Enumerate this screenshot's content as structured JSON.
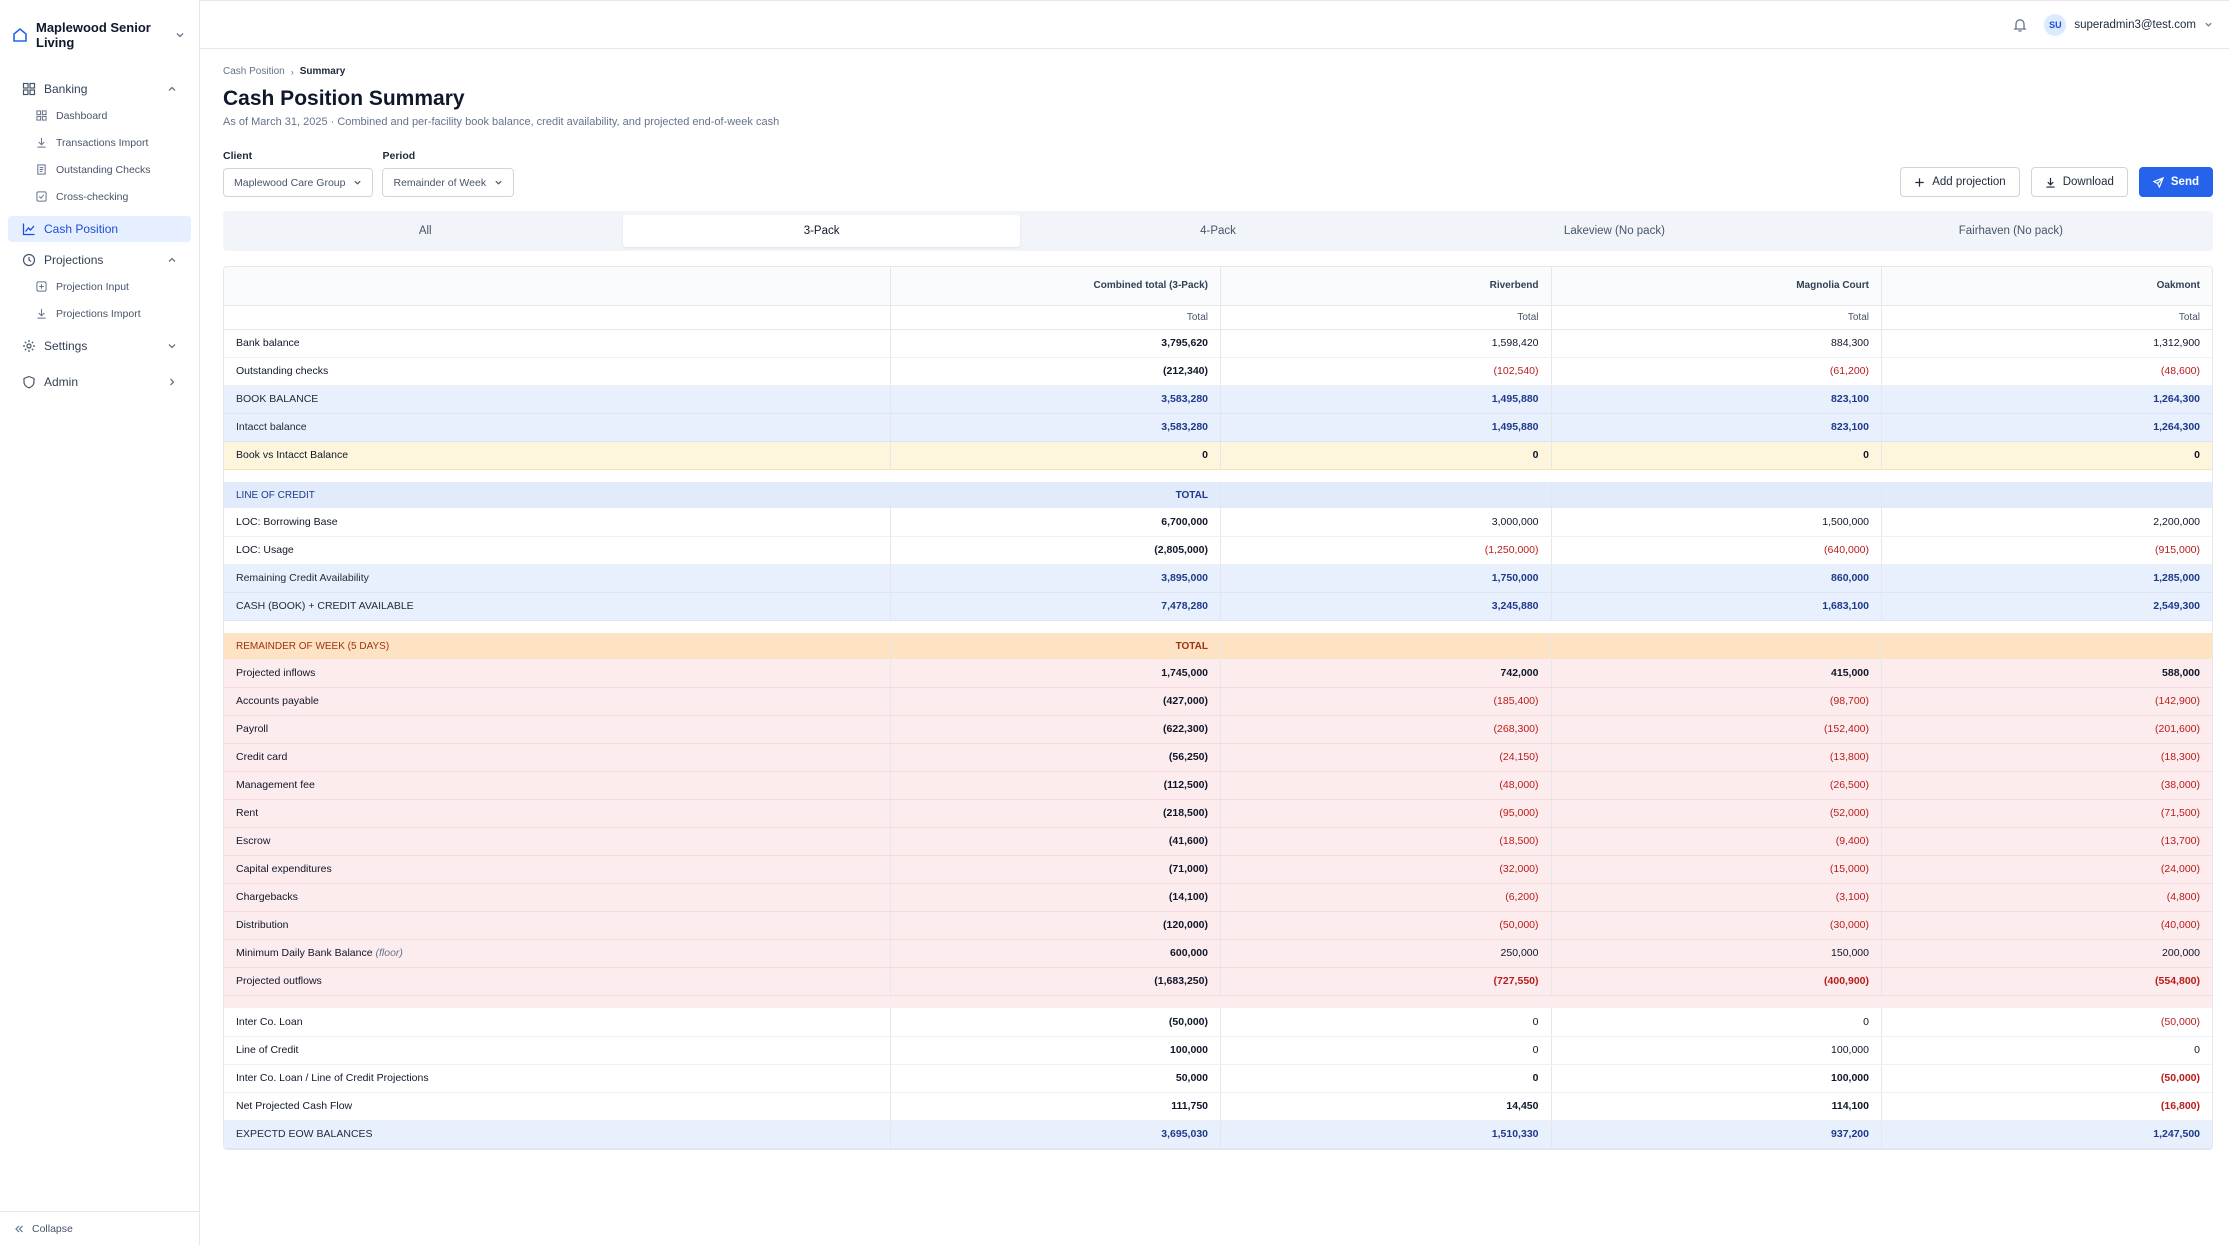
{
  "sidebar": {
    "org_name": "Maplewood Senior Living",
    "groups": {
      "banking": "Banking",
      "projections": "Projections",
      "settings": "Settings",
      "admin": "Admin"
    },
    "banking_items": [
      "Dashboard",
      "Transactions Import",
      "Outstanding Checks",
      "Cross-checking"
    ],
    "cash_position": "Cash Position",
    "projection_items": [
      "Projection Input",
      "Projections Import"
    ],
    "collapse": "Collapse"
  },
  "topbar": {
    "avatar_initials": "SU",
    "user_email": "superadmin3@test.com"
  },
  "breadcrumb": {
    "parent": "Cash Position",
    "current": "Summary"
  },
  "page": {
    "title": "Cash Position Summary",
    "subtitle": "As of March 31, 2025 · Combined and per-facility book balance, credit availability, and projected end-of-week cash"
  },
  "filters": {
    "client_label": "Client",
    "client_value": "Maplewood Care Group",
    "period_label": "Period",
    "period_value": "Remainder of Week"
  },
  "actions": {
    "add": "Add projection",
    "download": "Download",
    "send": "Send"
  },
  "tabs": [
    "All",
    "3-Pack",
    "4-Pack",
    "Lakeview (No pack)",
    "Fairhaven (No pack)"
  ],
  "active_tab": "3-Pack",
  "table": {
    "headers": [
      "Combined total (3-Pack)",
      "Riverbend",
      "Magnolia Court",
      "Oakmont"
    ],
    "subheaders": [
      "Total",
      "Total",
      "Total",
      "Total"
    ],
    "book": [
      {
        "label": "Bank balance",
        "vals": [
          "3,795,620",
          "1,598,420",
          "884,300",
          "1,312,900"
        ]
      },
      {
        "label": "Outstanding checks",
        "vals": [
          "(212,340)",
          "(102,540)",
          "(61,200)",
          "(48,600)"
        ]
      },
      {
        "label": "BOOK BALANCE",
        "vals": [
          "3,583,280",
          "1,495,880",
          "823,100",
          "1,264,300"
        ]
      },
      {
        "label": "Intacct balance",
        "vals": [
          "3,583,280",
          "1,495,880",
          "823,100",
          "1,264,300"
        ]
      },
      {
        "label": "Book vs Intacct Balance",
        "vals": [
          "0",
          "0",
          "0",
          "0"
        ]
      }
    ],
    "loc_header": {
      "label": "LINE OF CREDIT",
      "total": "TOTAL"
    },
    "loc": [
      {
        "label": "LOC: Borrowing Base",
        "vals": [
          "6,700,000",
          "3,000,000",
          "1,500,000",
          "2,200,000"
        ]
      },
      {
        "label": "LOC: Usage",
        "vals": [
          "(2,805,000)",
          "(1,250,000)",
          "(640,000)",
          "(915,000)"
        ]
      },
      {
        "label": "Remaining Credit Availability",
        "vals": [
          "3,895,000",
          "1,750,000",
          "860,000",
          "1,285,000"
        ]
      },
      {
        "label": "CASH (BOOK) + CREDIT AVAILABLE",
        "vals": [
          "7,478,280",
          "3,245,880",
          "1,683,100",
          "2,549,300"
        ]
      }
    ],
    "week_header": {
      "label": "REMAINDER OF WEEK (5 DAYS)",
      "total": "TOTAL"
    },
    "week": [
      {
        "label": "Projected inflows",
        "vals": [
          "1,745,000",
          "742,000",
          "415,000",
          "588,000"
        ]
      },
      {
        "label": "Accounts payable",
        "vals": [
          "(427,000)",
          "(185,400)",
          "(98,700)",
          "(142,900)"
        ]
      },
      {
        "label": "Payroll",
        "vals": [
          "(622,300)",
          "(268,300)",
          "(152,400)",
          "(201,600)"
        ]
      },
      {
        "label": "Credit card",
        "vals": [
          "(56,250)",
          "(24,150)",
          "(13,800)",
          "(18,300)"
        ]
      },
      {
        "label": "Management fee",
        "vals": [
          "(112,500)",
          "(48,000)",
          "(26,500)",
          "(38,000)"
        ]
      },
      {
        "label": "Rent",
        "vals": [
          "(218,500)",
          "(95,000)",
          "(52,000)",
          "(71,500)"
        ]
      },
      {
        "label": "Escrow",
        "vals": [
          "(41,600)",
          "(18,500)",
          "(9,400)",
          "(13,700)"
        ]
      },
      {
        "label": "Capital expenditures",
        "vals": [
          "(71,000)",
          "(32,000)",
          "(15,000)",
          "(24,000)"
        ]
      },
      {
        "label": "Chargebacks",
        "vals": [
          "(14,100)",
          "(6,200)",
          "(3,100)",
          "(4,800)"
        ]
      },
      {
        "label": "Distribution",
        "vals": [
          "(120,000)",
          "(50,000)",
          "(30,000)",
          "(40,000)"
        ]
      },
      {
        "label": "Minimum Daily Bank Balance",
        "note": "(floor)",
        "vals": [
          "600,000",
          "250,000",
          "150,000",
          "200,000"
        ]
      },
      {
        "label": "Projected outflows",
        "vals": [
          "(1,683,250)",
          "(727,550)",
          "(400,900)",
          "(554,800)"
        ]
      }
    ],
    "loans": [
      {
        "label": "Inter Co. Loan",
        "vals": [
          "(50,000)",
          "0",
          "0",
          "(50,000)"
        ]
      },
      {
        "label": "Line of Credit",
        "vals": [
          "100,000",
          "0",
          "100,000",
          "0"
        ]
      },
      {
        "label": "Inter Co. Loan / Line of Credit Projections",
        "vals": [
          "50,000",
          "0",
          "100,000",
          "(50,000)"
        ]
      },
      {
        "label": "Net Projected Cash Flow",
        "vals": [
          "111,750",
          "14,450",
          "114,100",
          "(16,800)"
        ]
      }
    ],
    "eow": {
      "label": "EXPECTD EOW BALANCES",
      "vals": [
        "3,695,030",
        "1,510,330",
        "937,200",
        "1,247,500"
      ]
    }
  }
}
